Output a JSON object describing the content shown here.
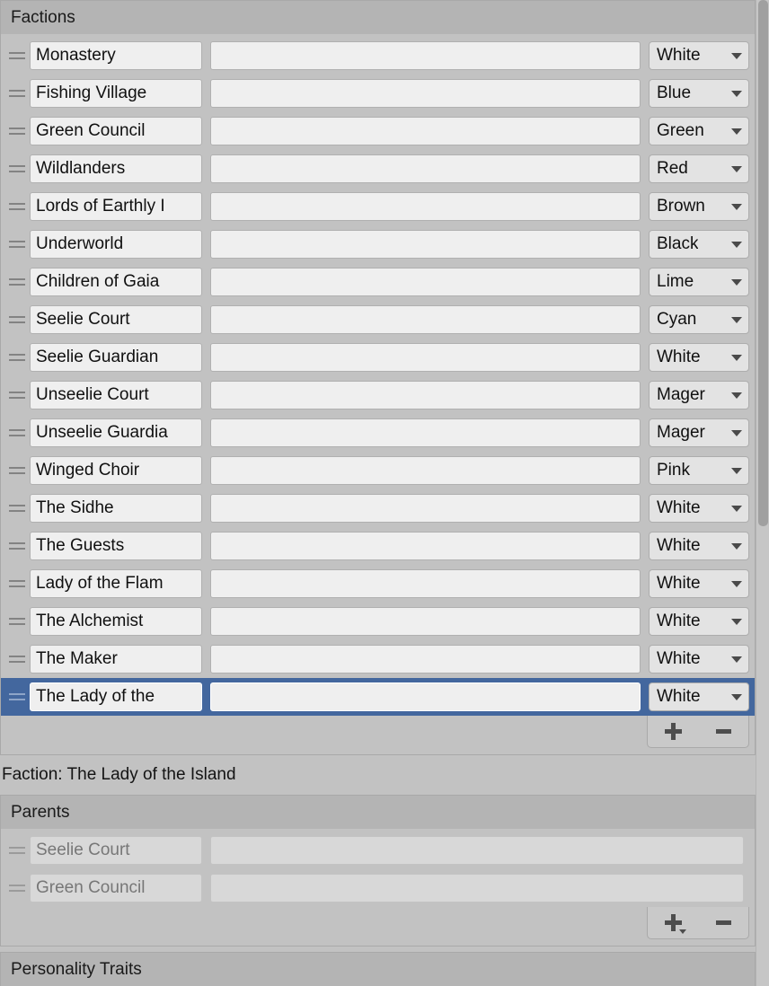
{
  "factions_panel": {
    "header": "Factions",
    "columns": [
      "name",
      "description",
      "color"
    ],
    "rows": [
      {
        "name": "Monastery",
        "description": "",
        "color": "White"
      },
      {
        "name": "Fishing Village",
        "description": "",
        "color": "Blue"
      },
      {
        "name": "Green Council",
        "description": "",
        "color": "Green"
      },
      {
        "name": "Wildlanders",
        "description": "",
        "color": "Red"
      },
      {
        "name": "Lords of Earthly I",
        "description": "",
        "color": "Brown"
      },
      {
        "name": "Underworld",
        "description": "",
        "color": "Black"
      },
      {
        "name": "Children of Gaia",
        "description": "",
        "color": "Lime"
      },
      {
        "name": "Seelie Court",
        "description": "",
        "color": "Cyan"
      },
      {
        "name": "Seelie Guardian",
        "description": "",
        "color": "White"
      },
      {
        "name": "Unseelie Court",
        "description": "",
        "color": "Mager"
      },
      {
        "name": "Unseelie Guardia",
        "description": "",
        "color": "Mager"
      },
      {
        "name": "Winged Choir",
        "description": "",
        "color": "Pink"
      },
      {
        "name": "The Sidhe",
        "description": "",
        "color": "White"
      },
      {
        "name": "The Guests",
        "description": "",
        "color": "White"
      },
      {
        "name": "Lady of the Flam",
        "description": "",
        "color": "White"
      },
      {
        "name": "The Alchemist",
        "description": "",
        "color": "White"
      },
      {
        "name": "The Maker",
        "description": "",
        "color": "White"
      },
      {
        "name": "The Lady of the",
        "description": "",
        "color": "White"
      }
    ],
    "selected_index": 17,
    "add_label": "+",
    "remove_label": "−"
  },
  "detail": {
    "faction_line": "Faction: The Lady of the Island"
  },
  "parents_panel": {
    "header": "Parents",
    "rows": [
      {
        "name": "Seelie Court",
        "description": ""
      },
      {
        "name": "Green Council",
        "description": ""
      }
    ],
    "add_label": "+",
    "remove_label": "−"
  },
  "traits_panel": {
    "header": "Personality Traits"
  },
  "colors": {
    "window_bg": "#c2c2c2",
    "header_bg": "#b4b4b4",
    "selection_blue": "#43679e",
    "field_bg": "#efefef",
    "dropdown_bg": "#e3e3e3",
    "scrollbar_thumb": "#a0a0a0"
  }
}
